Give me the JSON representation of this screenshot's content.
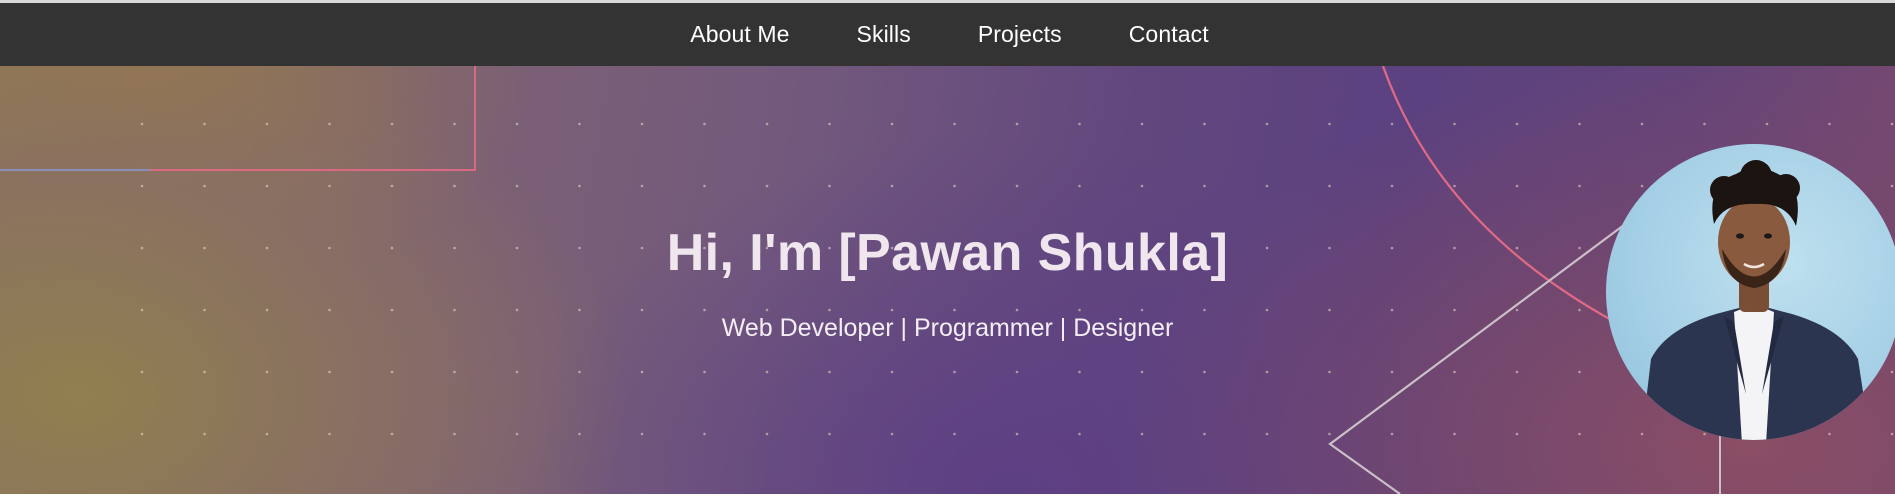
{
  "nav": {
    "items": [
      {
        "label": "About Me"
      },
      {
        "label": "Skills"
      },
      {
        "label": "Projects"
      },
      {
        "label": "Contact"
      }
    ]
  },
  "hero": {
    "title": "Hi, I'm [Pawan Shukla]",
    "subtitle": "Web Developer | Programmer | Designer",
    "avatar_icon": "profile-photo"
  },
  "colors": {
    "navbar_bg": "#333333",
    "nav_text": "#ffffff",
    "hero_text": "#f0e6ee",
    "accent_pink": "#e06a86",
    "accent_gray": "#c9bdc4",
    "avatar_bg": "#a6d0e6"
  }
}
